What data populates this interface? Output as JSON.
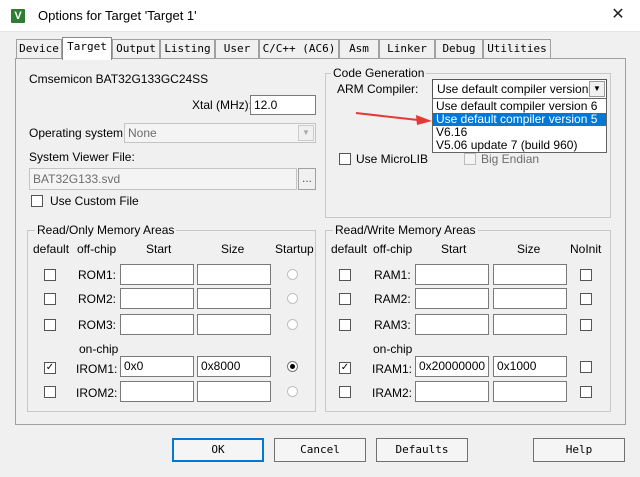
{
  "window": {
    "title": "Options for Target 'Target 1'",
    "icon_letter": "V",
    "close_glyph": "✕"
  },
  "tabs": [
    "Device",
    "Target",
    "Output",
    "Listing",
    "User",
    "C/C++ (AC6)",
    "Asm",
    "Linker",
    "Debug",
    "Utilities"
  ],
  "device": {
    "name": "Cmsemicon BAT32G133GC24SS",
    "xtal_label": "Xtal (MHz):",
    "xtal_value": "12.0"
  },
  "os": {
    "label": "Operating system:",
    "value": "None"
  },
  "svd": {
    "label": "System Viewer File:",
    "value": "BAT32G133.svd",
    "browse": "..."
  },
  "custom_file": {
    "label": "Use Custom File"
  },
  "codegen": {
    "title": "Code Generation",
    "compiler_label": "ARM Compiler:",
    "compiler_value": "Use default compiler version 6",
    "options": [
      "Use default compiler version 6",
      "Use default compiler version 5",
      "V6.16",
      "V5.06 update 7 (build 960)"
    ],
    "microlib_label": "Use MicroLIB",
    "bigendian_label": "Big Endian"
  },
  "ro": {
    "title": "Read/Only Memory Areas",
    "headers": {
      "default": "default",
      "offchip": "off-chip",
      "start": "Start",
      "size": "Size",
      "startup": "Startup"
    },
    "onchip_label": "on-chip",
    "rows": [
      {
        "label": "ROM1:",
        "start": "",
        "size": ""
      },
      {
        "label": "ROM2:",
        "start": "",
        "size": ""
      },
      {
        "label": "ROM3:",
        "start": "",
        "size": ""
      },
      {
        "label": "IROM1:",
        "start": "0x0",
        "size": "0x8000"
      },
      {
        "label": "IROM2:",
        "start": "",
        "size": ""
      }
    ]
  },
  "rw": {
    "title": "Read/Write Memory Areas",
    "headers": {
      "default": "default",
      "offchip": "off-chip",
      "start": "Start",
      "size": "Size",
      "noinit": "NoInit"
    },
    "onchip_label": "on-chip",
    "rows": [
      {
        "label": "RAM1:",
        "start": "",
        "size": ""
      },
      {
        "label": "RAM2:",
        "start": "",
        "size": ""
      },
      {
        "label": "RAM3:",
        "start": "",
        "size": ""
      },
      {
        "label": "IRAM1:",
        "start": "0x20000000",
        "size": "0x1000"
      },
      {
        "label": "IRAM2:",
        "start": "",
        "size": ""
      }
    ]
  },
  "buttons": {
    "ok": "OK",
    "cancel": "Cancel",
    "defaults": "Defaults",
    "help": "Help"
  },
  "check_glyph": "✓",
  "colors": {
    "highlight": "#0078d7",
    "annotation_arrow": "#e53935",
    "app_icon": "#2e7d32"
  }
}
